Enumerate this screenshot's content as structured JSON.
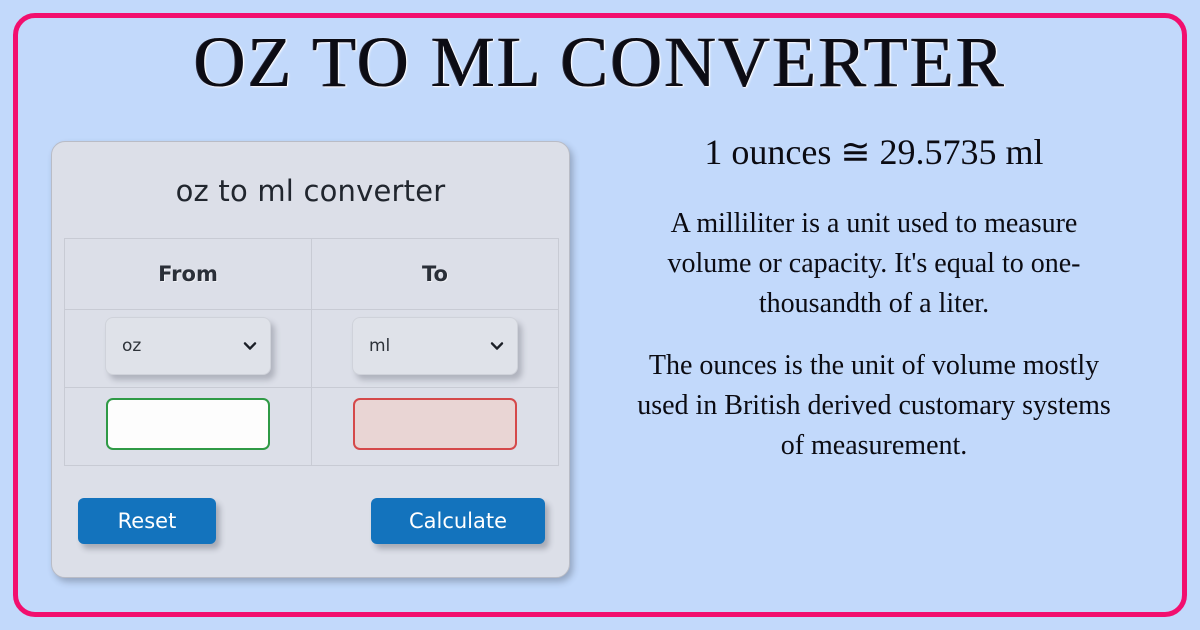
{
  "headline": "OZ TO ML CONVERTER",
  "colors": {
    "background": "#c2d9fb",
    "frame_border": "#f20f6e",
    "card_background": "#dcdfe8",
    "button_blue": "#1373bd",
    "input_from_border": "#2f9a46",
    "input_to_border": "#d5494a",
    "input_to_fill": "#e9d5d4"
  },
  "converter": {
    "title": "oz to ml converter",
    "columns": [
      "From",
      "To"
    ],
    "from": {
      "unit": "oz",
      "value": "",
      "placeholder": ""
    },
    "to": {
      "unit": "ml",
      "value": "",
      "placeholder": ""
    },
    "chevron_icon": "chevron-down-icon",
    "reset_label": "Reset",
    "calculate_label": "Calculate"
  },
  "info": {
    "equation": "1 ounces ≅ 29.5735 ml",
    "paragraph_1": "A milliliter is a unit used to measure volume or capacity. It's equal to one-thousandth of a liter.",
    "paragraph_2": "The ounces is the unit of volume mostly used in British derived customary systems of measurement."
  }
}
